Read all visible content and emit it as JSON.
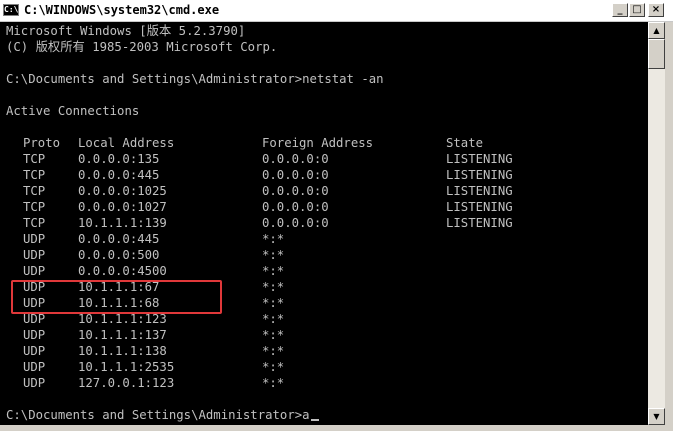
{
  "window": {
    "title": "C:\\WINDOWS\\system32\\cmd.exe",
    "icon_text": "C:\\",
    "icon": "cmd-icon",
    "buttons": {
      "minimize": "_",
      "maximize": "□",
      "close": "×"
    }
  },
  "console": {
    "header_lines": [
      "Microsoft Windows [版本 5.2.3790]",
      "(C) 版权所有 1985-2003 Microsoft Corp."
    ],
    "command_line": "C:\\Documents and Settings\\Administrator>netstat -an",
    "section_title": "Active Connections",
    "columns": {
      "proto": "Proto",
      "local": "Local Address",
      "foreign": "Foreign Address",
      "state": "State"
    },
    "rows": [
      {
        "proto": "TCP",
        "local": "0.0.0.0:135",
        "foreign": "0.0.0.0:0",
        "state": "LISTENING"
      },
      {
        "proto": "TCP",
        "local": "0.0.0.0:445",
        "foreign": "0.0.0.0:0",
        "state": "LISTENING"
      },
      {
        "proto": "TCP",
        "local": "0.0.0.0:1025",
        "foreign": "0.0.0.0:0",
        "state": "LISTENING"
      },
      {
        "proto": "TCP",
        "local": "0.0.0.0:1027",
        "foreign": "0.0.0.0:0",
        "state": "LISTENING"
      },
      {
        "proto": "TCP",
        "local": "10.1.1.1:139",
        "foreign": "0.0.0.0:0",
        "state": "LISTENING"
      },
      {
        "proto": "UDP",
        "local": "0.0.0.0:445",
        "foreign": "*:*",
        "state": ""
      },
      {
        "proto": "UDP",
        "local": "0.0.0.0:500",
        "foreign": "*:*",
        "state": ""
      },
      {
        "proto": "UDP",
        "local": "0.0.0.0:4500",
        "foreign": "*:*",
        "state": ""
      },
      {
        "proto": "UDP",
        "local": "10.1.1.1:67",
        "foreign": "*:*",
        "state": ""
      },
      {
        "proto": "UDP",
        "local": "10.1.1.1:68",
        "foreign": "*:*",
        "state": ""
      },
      {
        "proto": "UDP",
        "local": "10.1.1.1:123",
        "foreign": "*:*",
        "state": ""
      },
      {
        "proto": "UDP",
        "local": "10.1.1.1:137",
        "foreign": "*:*",
        "state": ""
      },
      {
        "proto": "UDP",
        "local": "10.1.1.1:138",
        "foreign": "*:*",
        "state": ""
      },
      {
        "proto": "UDP",
        "local": "10.1.1.1:2535",
        "foreign": "*:*",
        "state": ""
      },
      {
        "proto": "UDP",
        "local": "127.0.0.1:123",
        "foreign": "*:*",
        "state": ""
      }
    ],
    "prompt_line": "C:\\Documents and Settings\\Administrator>a"
  },
  "colors": {
    "console_background": "#000000",
    "console_text": "#c0c0c0",
    "highlight_border": "#e0383a"
  }
}
